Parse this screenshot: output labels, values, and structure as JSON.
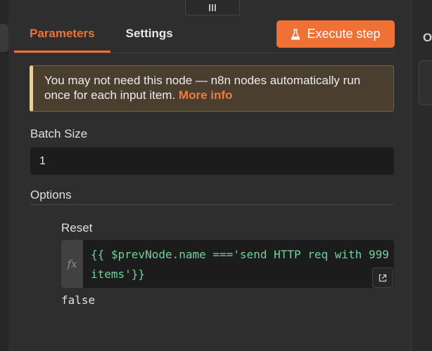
{
  "tabs": [
    {
      "label": "Parameters",
      "active": true
    },
    {
      "label": "Settings",
      "active": false
    }
  ],
  "execute_button": {
    "label": "Execute step",
    "icon": "flask-icon"
  },
  "notice": {
    "text": "You may not need this node — n8n nodes automatically run once for each input item.",
    "link": "More info"
  },
  "batch_size": {
    "label": "Batch Size",
    "value": "1"
  },
  "options": {
    "label": "Options"
  },
  "reset": {
    "label": "Reset",
    "fx_label": "fx",
    "expression": "{{ $prevNode.name ==='send HTTP req with 999 items'}}",
    "result": "false"
  },
  "right_panel": {
    "letter": "O"
  },
  "colors": {
    "accent": "#ef7135",
    "code": "#6ed39a",
    "background": "#2e2e2e"
  }
}
